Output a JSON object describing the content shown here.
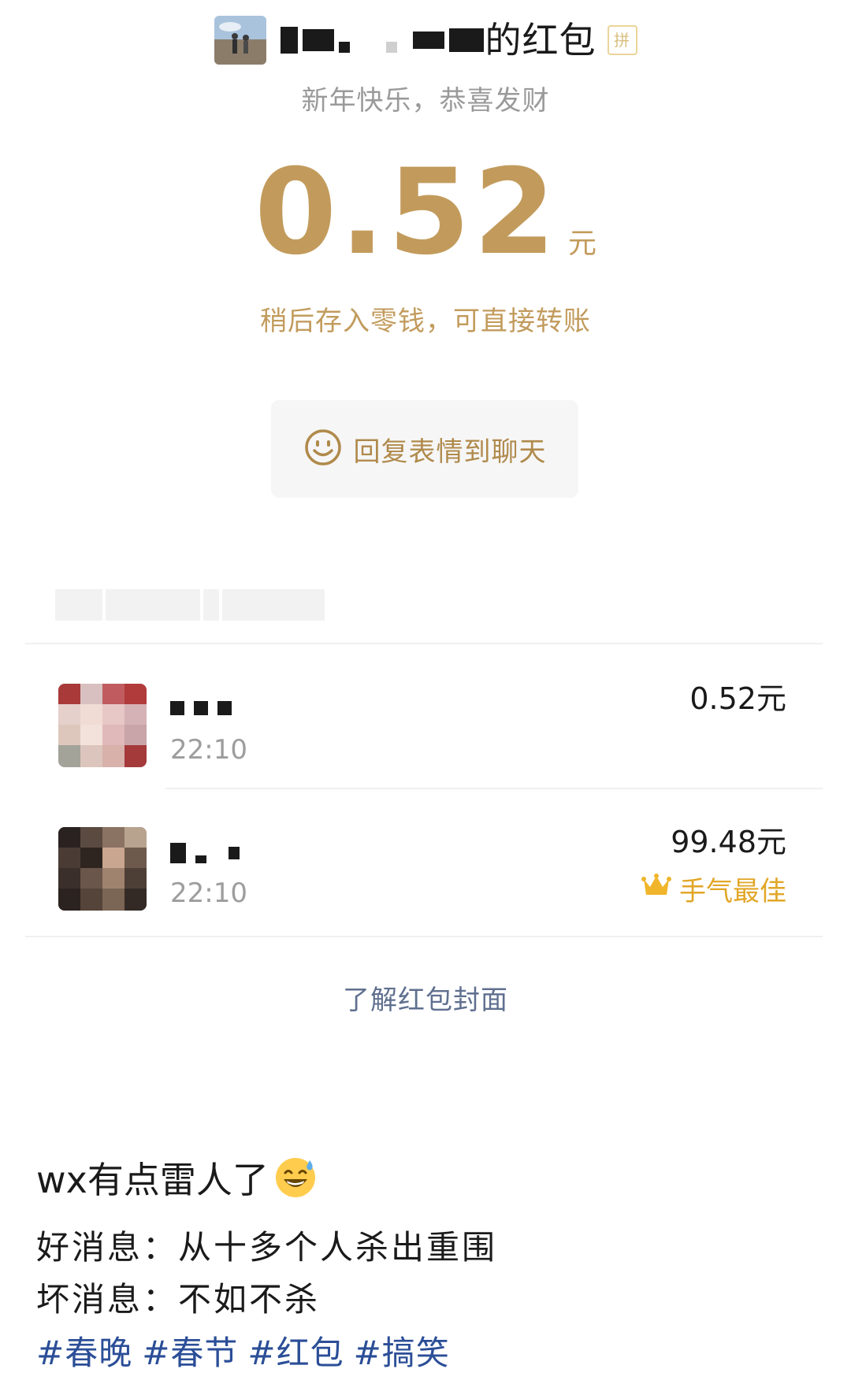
{
  "header": {
    "sender_name_suffix": "的红包",
    "tag_glyph": "拼",
    "greeting": "新年快乐，恭喜发财"
  },
  "amount": {
    "value": "0.52",
    "unit": "元"
  },
  "note": "稍后存入零钱，可直接转账",
  "reply_button": {
    "label": "回复表情到聊天"
  },
  "recipients": [
    {
      "time": "22:10",
      "amount": "0.52元"
    },
    {
      "time": "22:10",
      "amount": "99.48元",
      "badge": "手气最佳"
    }
  ],
  "cover_link": "了解红包封面",
  "post": {
    "caption": "wx有点雷人了",
    "caption_emoji": "grinning-sweat-emoji",
    "line1": "好消息：从十多个人杀出重围",
    "line2": "坏消息：不如不杀",
    "hashtags": [
      "#春晚",
      "#春节",
      "#红包",
      "#搞笑"
    ]
  },
  "colors": {
    "gold": "#c29b5c",
    "link": "#5f6f8f",
    "hashtag": "#2b4e97",
    "best_luck": "#e2a627"
  }
}
